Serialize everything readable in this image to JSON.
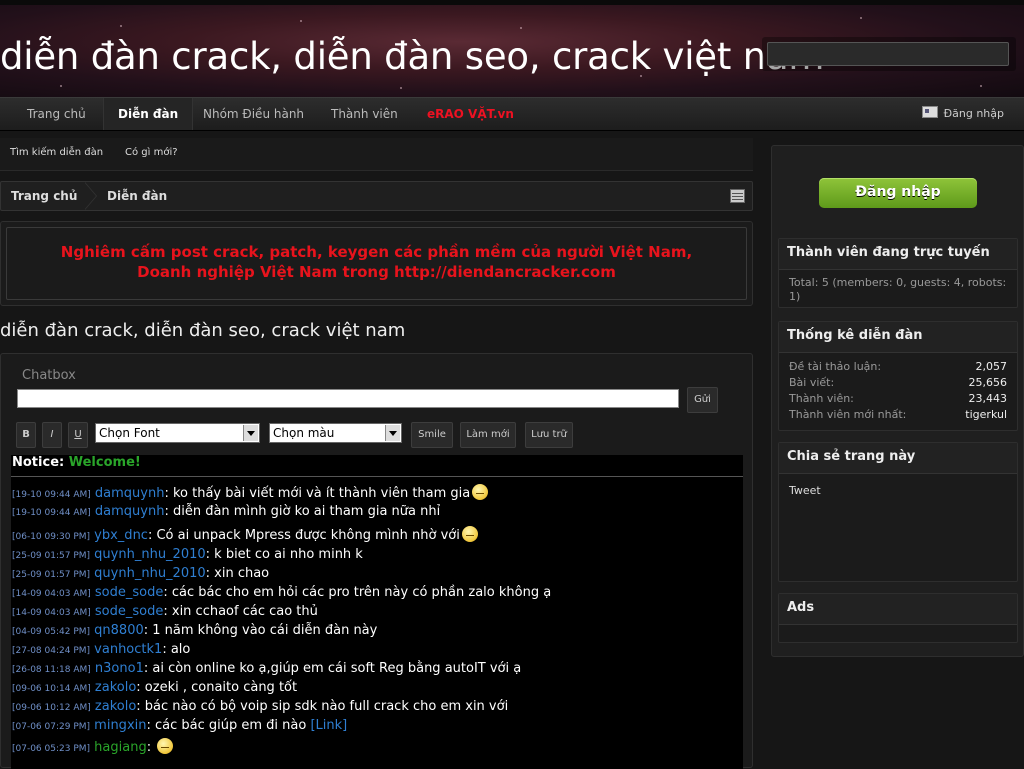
{
  "header": {
    "site_title": "diễn đàn crack, diễn đàn seo, crack việt nam",
    "search_placeholder": ""
  },
  "nav": {
    "items": [
      "Trang chủ",
      "Diễn đàn",
      "Nhóm Điều hành",
      "Thành viên",
      "eRAO VẶT.vn"
    ],
    "login": "Đăng nhập"
  },
  "subnav": {
    "search": "Tìm kiếm diễn đàn",
    "whats_new": "Có gì mới?"
  },
  "breadcrumb": [
    "Trang chủ",
    "Diễn đàn"
  ],
  "notice": {
    "line1": "Nghiêm cấm post crack, patch, keygen các phần mềm của người Việt Nam,",
    "line2": "Doanh nghiệp Việt Nam trong http://diendancracker.com"
  },
  "forum_title": "diễn đàn crack, diễn đàn seo, crack việt nam",
  "chatbox": {
    "label": "Chatbox",
    "send": "Gửi",
    "bold": "B",
    "italic": "I",
    "underline": "U",
    "font_select": "Chọn Font",
    "color_select": "Chọn màu",
    "smile": "Smile",
    "refresh": "Làm mới",
    "archive": "Lưu trữ",
    "notice_label": "Notice:",
    "notice_text": "Welcome!",
    "messages": [
      {
        "ts": "[19-10 09:44 AM]",
        "user": "damquynh",
        "text": ": ko thấy bài viết mới và ít thành viên tham gia",
        "smiley": true
      },
      {
        "ts": "[19-10 09:44 AM]",
        "user": "damquynh",
        "text": ": diễn đàn mình giờ ko ai tham gia nữa nhỉ"
      },
      {
        "ts": "[06-10 09:30 PM]",
        "user": "ybx_dnc",
        "text": ": Có ai unpack Mpress được không mình nhờ với",
        "smiley": true
      },
      {
        "ts": "[25-09 01:57 PM]",
        "user": "quynh_nhu_2010",
        "text": ": k biet co ai nho minh k"
      },
      {
        "ts": "[25-09 01:57 PM]",
        "user": "quynh_nhu_2010",
        "text": ": xin chao"
      },
      {
        "ts": "[14-09 04:03 AM]",
        "user": "sode_sode",
        "text": ": các bác cho em hỏi các pro trên này có phần zalo không ạ"
      },
      {
        "ts": "[14-09 04:03 AM]",
        "user": "sode_sode",
        "text": ": xin cchaof các cao thủ"
      },
      {
        "ts": "[04-09 05:42 PM]",
        "user": "qn8800",
        "text": ": 1 năm không vào cái diễn đàn này"
      },
      {
        "ts": "[27-08 04:24 PM]",
        "user": "vanhoctk1",
        "text": ": alo"
      },
      {
        "ts": "[26-08 11:18 AM]",
        "user": "n3ono1",
        "text": ": ai còn online ko ạ,giúp em cái soft Reg bằng autoIT với ạ"
      },
      {
        "ts": "[09-06 10:14 AM]",
        "user": "zakolo",
        "text": ": ozeki , conaito càng tốt"
      },
      {
        "ts": "[09-06 10:12 AM]",
        "user": "zakolo",
        "text": ": bác nào có bộ voip sip sdk nào full crack cho em xin với"
      },
      {
        "ts": "[07-06 07:29 PM]",
        "user": "mingxin",
        "text": ": các bác giúp em đi nào ",
        "link": "[Link]"
      },
      {
        "ts": "[07-06 05:23 PM]",
        "user": "hagiang",
        "text": ": ",
        "smiley": true,
        "green": true
      }
    ]
  },
  "sidebar": {
    "login_button": "Đăng nhập",
    "online": {
      "title": "Thành viên đang trực tuyến",
      "text": "Total: 5 (members: 0, guests: 4, robots: 1)"
    },
    "stats": {
      "title": "Thống kê diễn đàn",
      "rows": [
        {
          "label": "Đề tài thảo luận:",
          "value": "2,057"
        },
        {
          "label": "Bài viết:",
          "value": "25,656"
        },
        {
          "label": "Thành viên:",
          "value": "23,443"
        },
        {
          "label": "Thành viên mới nhất:",
          "value": "tigerkul"
        }
      ]
    },
    "share": {
      "title": "Chia sẻ trang này",
      "tweet": "Tweet"
    },
    "ads": {
      "title": "Ads"
    }
  },
  "colors": {
    "background": "#161616",
    "notice_red": "#e8131c",
    "login_green": "#7ab02a",
    "username_blue": "#2f7fd2"
  }
}
